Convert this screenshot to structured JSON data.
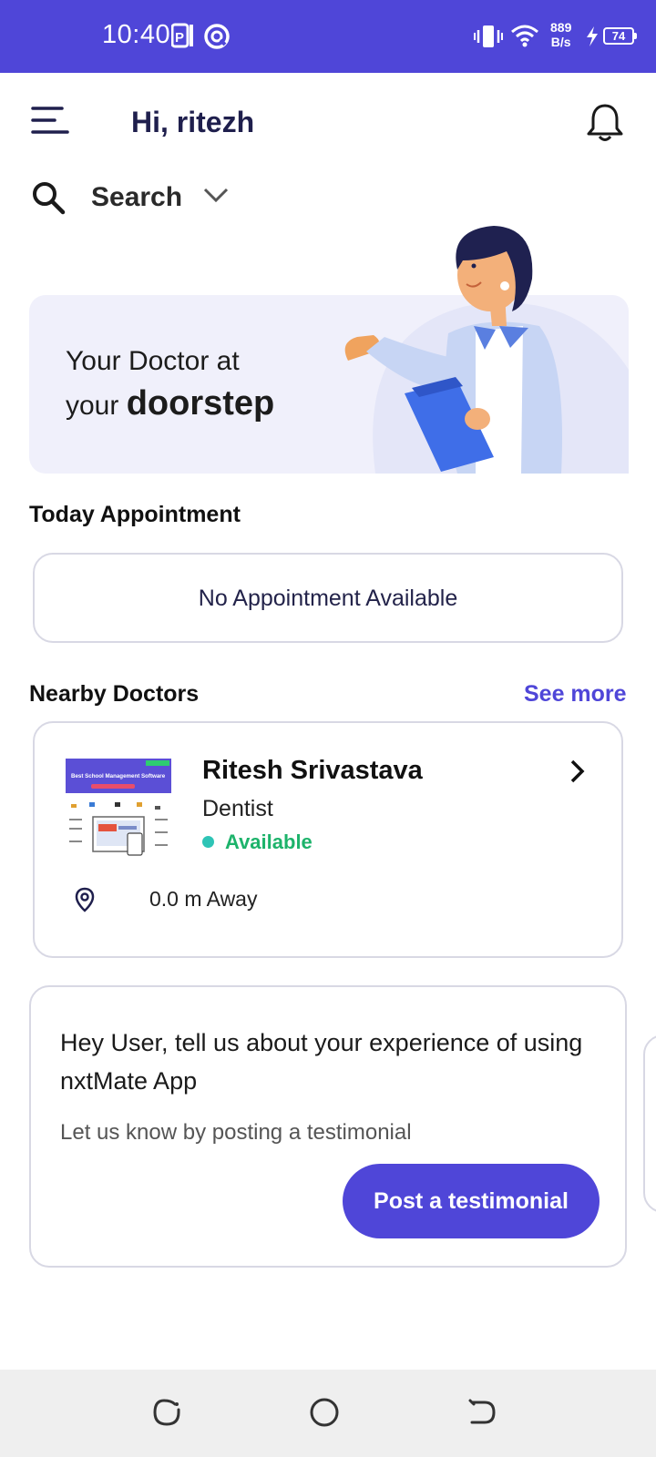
{
  "status_bar": {
    "time": "10:40",
    "net_speed_value": "889",
    "net_speed_unit": "B/s",
    "battery": "74",
    "icons": [
      "parking-icon",
      "data-saver-icon",
      "vibrate-icon",
      "wifi-icon",
      "charging-icon",
      "battery-icon"
    ]
  },
  "header": {
    "greeting": "Hi, ritezh",
    "menu_icon": "hamburger-menu-icon",
    "notification_icon": "bell-icon"
  },
  "search": {
    "label": "Search",
    "icon": "search-icon",
    "dropdown_icon": "chevron-down-icon"
  },
  "banner": {
    "line1": "Your Doctor at",
    "line2_prefix": "your ",
    "line2_bold": "doorstep"
  },
  "today_appointment": {
    "title": "Today Appointment",
    "empty_text": "No Appointment Available"
  },
  "nearby_doctors": {
    "title": "Nearby Doctors",
    "see_more": "See more",
    "doctors": [
      {
        "name": "Ritesh Srivastava",
        "specialty": "Dentist",
        "status": "Available",
        "distance": "0.0 m Away",
        "thumbnail_headline": "Best School Management Software"
      }
    ]
  },
  "testimonial": {
    "title": "Hey User, tell us about your experience of using nxtMate App",
    "subtitle": "Let us know by posting a testimonial",
    "button": "Post a testimonial"
  },
  "colors": {
    "brand": "#4f46d8",
    "available": "#1db36b",
    "banner_bg": "#f0f0fb"
  },
  "nav_bar": {
    "icons": [
      "recents-icon",
      "home-icon",
      "back-icon"
    ]
  }
}
